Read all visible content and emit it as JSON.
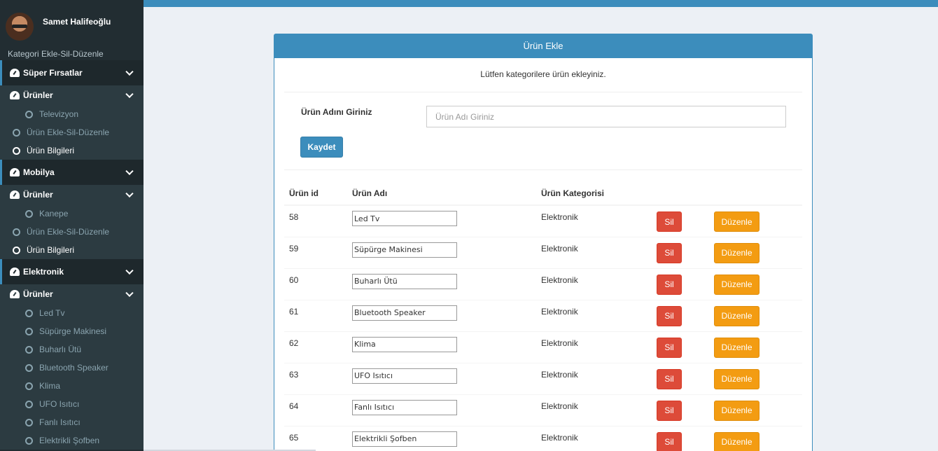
{
  "user": {
    "name": "Samet Halifeoğlu"
  },
  "sidebar": {
    "header": "Kategori Ekle-Sil-Düzenle",
    "groups": [
      {
        "label": "Süper Fırsatlar",
        "sub_label": "Ürünler",
        "children": [
          "Televizyon"
        ],
        "links": [
          "Ürün Ekle-Sil-Düzenle",
          "Ürün Bilgileri"
        ]
      },
      {
        "label": "Mobilya",
        "sub_label": "Ürünler",
        "children": [
          "Kanepe"
        ],
        "links": [
          "Ürün Ekle-Sil-Düzenle",
          "Ürün Bilgileri"
        ]
      },
      {
        "label": "Elektronik",
        "sub_label": "Ürünler",
        "children": [
          "Led Tv",
          "Süpürge Makinesi",
          "Buharlı Ütü",
          "Bluetooth Speaker",
          "Klima",
          "UFO Isıtıcı",
          "Fanlı Isıtıcı",
          "Elektrikli Şofben"
        ]
      }
    ]
  },
  "panel": {
    "title": "Ürün Ekle",
    "intro": "Lütfen kategorilere ürün ekleyiniz.",
    "form_label": "Ürün Adını Giriniz",
    "input_placeholder": "Ürün Adı Giriniz",
    "save_label": "Kaydet"
  },
  "table": {
    "headers": [
      "Ürün id",
      "Ürün Adı",
      "Ürün Kategorisi"
    ],
    "delete_label": "Sil",
    "edit_label": "Düzenle",
    "rows": [
      {
        "id": "58",
        "name": "Led Tv",
        "category": "Elektronik"
      },
      {
        "id": "59",
        "name": "Süpürge Makinesi",
        "category": "Elektronik"
      },
      {
        "id": "60",
        "name": "Buharlı Ütü",
        "category": "Elektronik"
      },
      {
        "id": "61",
        "name": "Bluetooth Speaker",
        "category": "Elektronik"
      },
      {
        "id": "62",
        "name": "Klima",
        "category": "Elektronik"
      },
      {
        "id": "63",
        "name": "UFO Isıtıcı",
        "category": "Elektronik"
      },
      {
        "id": "64",
        "name": "Fanlı Isıtıcı",
        "category": "Elektronik"
      },
      {
        "id": "65",
        "name": "Elektrikli Şofben",
        "category": "Elektronik"
      }
    ]
  },
  "colors": {
    "primary": "#3c8dbc",
    "danger": "#dd4b39",
    "warning": "#f39c12",
    "sidebar_bg": "#222d32"
  }
}
